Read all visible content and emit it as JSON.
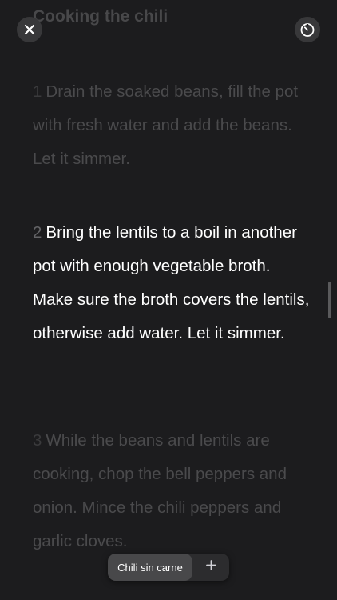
{
  "header": {
    "section_title": "Cooking the chili",
    "close_icon": "close-icon",
    "timer_icon": "timer-icon"
  },
  "steps": [
    {
      "number": "1",
      "text": "Drain the soaked beans, fill the pot with fresh water and add the beans. Let it simmer.",
      "active": false
    },
    {
      "number": "2",
      "text": "Bring the lentils to a boil in another pot with enough vegetable broth. Make sure the broth covers the lentils, otherwise add water. Let it simmer.",
      "active": true
    },
    {
      "number": "3",
      "text": "While the beans and lentils are cooking, chop the bell peppers and onion. Mince the chili peppers and garlic cloves.",
      "active": false
    }
  ],
  "bottom_bar": {
    "recipe_label": "Chili sin carne",
    "add_icon": "plus-icon"
  },
  "colors": {
    "background": "#1c1c1e",
    "active_text": "#ffffff",
    "inactive_text": "#4a4a4c"
  }
}
